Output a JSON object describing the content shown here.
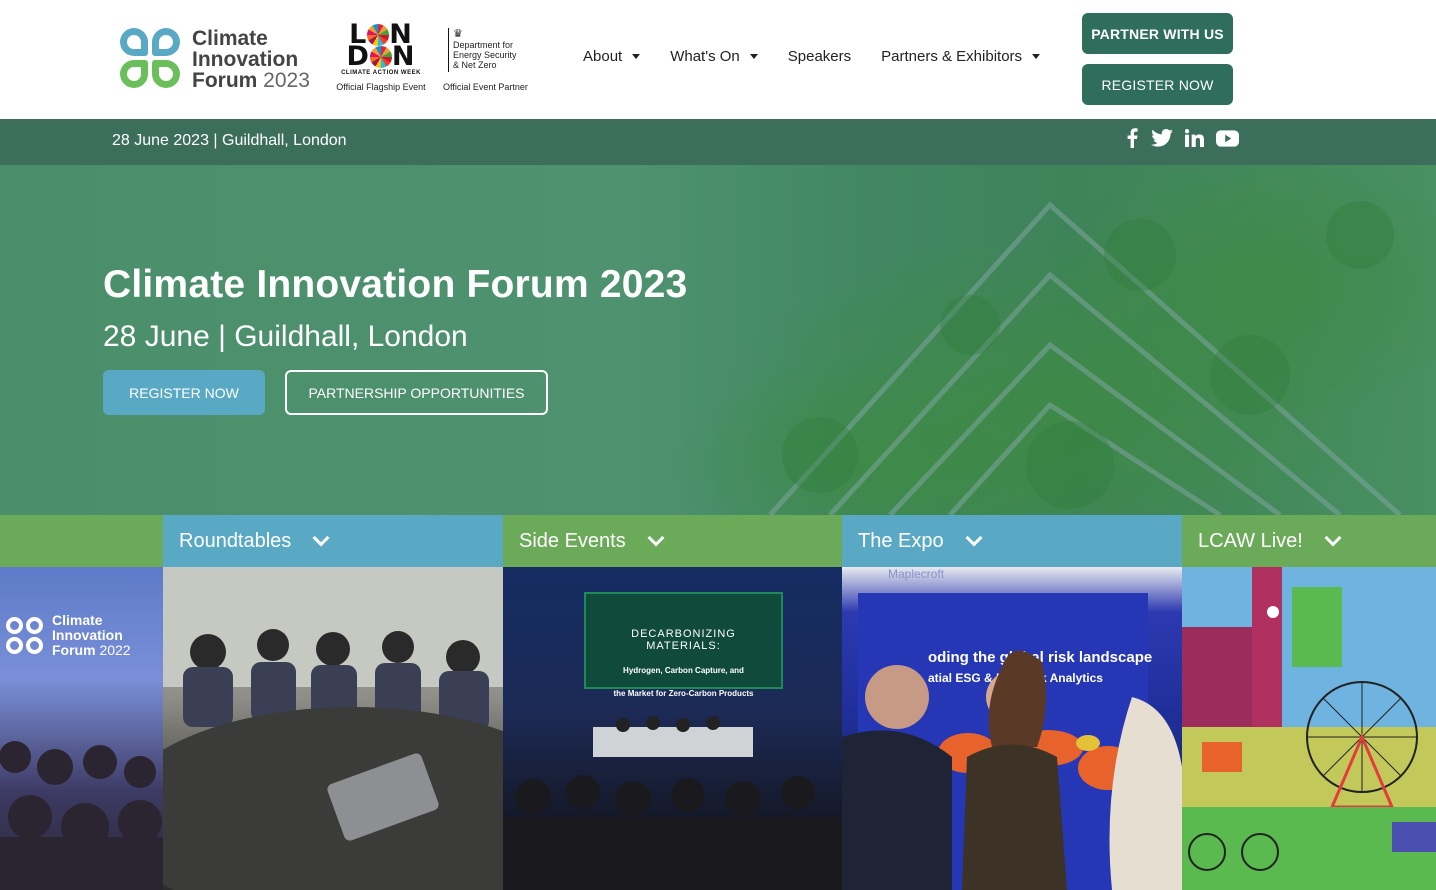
{
  "header": {
    "logo": {
      "line1": "Climate",
      "line2": "Innovation",
      "line3": "Forum",
      "year": "2023"
    },
    "london_logo": {
      "word_top_l": "L",
      "word_top_n": "N",
      "word_bottom_d": "D",
      "word_bottom_n": "N",
      "subtitle": "CLIMATE ACTION WEEK",
      "caption": "Official Flagship Event"
    },
    "desnz_logo": {
      "line1": "Department for",
      "line2": "Energy Security",
      "line3": "& Net Zero",
      "caption": "Official Event Partner"
    },
    "nav": [
      {
        "label": "About",
        "has_dropdown": true
      },
      {
        "label": "What's On",
        "has_dropdown": true
      },
      {
        "label": "Speakers",
        "has_dropdown": false
      },
      {
        "label": "Partners & Exhibitors",
        "has_dropdown": true
      }
    ],
    "partner_button": "PARTNER WITH US",
    "register_button": "REGISTER NOW"
  },
  "infobar": {
    "text": "28 June 2023 | Guildhall, London",
    "socials": [
      "facebook-icon",
      "twitter-icon",
      "linkedin-icon",
      "youtube-icon"
    ]
  },
  "hero": {
    "title": "Climate Innovation Forum 2023",
    "subtitle": "28 June | Guildhall, London",
    "register_button": "REGISTER NOW",
    "partnership_button": "PARTNERSHIP OPPORTUNITIES"
  },
  "tabs": [
    {
      "label": "Roundtables"
    },
    {
      "label": "Side Events"
    },
    {
      "label": "The Expo"
    },
    {
      "label": "LCAW Live!"
    }
  ],
  "photos": {
    "stage_logo": {
      "line1": "Climate",
      "line2": "Innovation",
      "line3": "Forum",
      "year": "2022"
    },
    "screen": {
      "title_line1": "DECARBONIZING",
      "title_line2": "MATERIALS:",
      "sub_line1": "Hydrogen, Carbon Capture, and",
      "sub_line2": "the Market for Zero-Carbon Products"
    },
    "banner": {
      "brand": "Maplecroft",
      "line1": "oding the global risk landscape",
      "line2": "atial ESG & Poli   Risk Analytics"
    }
  },
  "colors": {
    "brand_green_dark": "#2f6d5c",
    "infobar": "#3c6e5c",
    "accent_blue": "#5aa9c4",
    "accent_green": "#6aaa58"
  }
}
